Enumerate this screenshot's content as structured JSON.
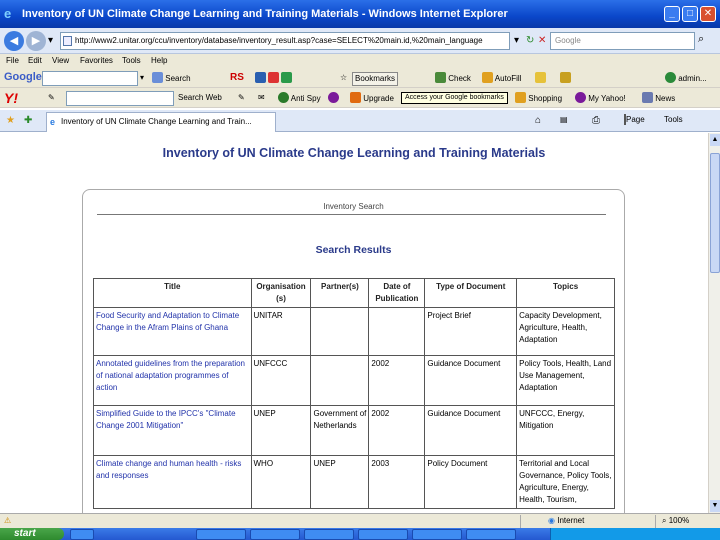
{
  "window": {
    "title": "Inventory of UN Climate Change Learning and Training Materials - Windows Internet Explorer",
    "minimize_label": "_",
    "maximize_label": "□",
    "close_label": "✕"
  },
  "address_bar": {
    "url": "http://www2.unitar.org/ccu/inventory/database/inventory_result.asp?case=SELECT%20main.id,%20main_language",
    "search_placeholder": "Google"
  },
  "menu": [
    "File",
    "Edit",
    "View",
    "Favorites",
    "Tools",
    "Help"
  ],
  "google_toolbar": {
    "logo": "Google",
    "search_label": "Search",
    "rss_label": "RS",
    "bookmarks_label": "Bookmarks",
    "check_label": "Check",
    "autofill_label": "AutoFill",
    "account_label": "admin..."
  },
  "yahoo_toolbar": {
    "logo": "Y!",
    "search_web_label": "Search Web",
    "anti_spy_label": "Anti Spy",
    "upgrade_label": "Upgrade",
    "tooltip": "Access your Google bookmarks",
    "shopping_label": "Shopping",
    "my_yahoo_label": "My Yahoo!",
    "news_label": "News"
  },
  "tabs": {
    "active_tab_title": "Inventory of UN Climate Change Learning and Train...",
    "page_label": "Page",
    "tools_label": "Tools"
  },
  "page": {
    "title": "Inventory of UN Climate Change Learning and Training Materials",
    "inventory_search_label": "Inventory Search",
    "results_title": "Search Results",
    "table": {
      "headers": [
        "Title",
        "Organisation (s)",
        "Partner(s)",
        "Date of Publication",
        "Type of Document",
        "Topics"
      ],
      "rows": [
        {
          "title": "Food Security and Adaptation to Climate Change in the Afram Plains of Ghana",
          "organisation": "UNITAR",
          "partners": "",
          "date": "",
          "type": "Project Brief",
          "topics": "Capacity Development, Agriculture, Health, Adaptation"
        },
        {
          "title": "Annotated guidelines from the preparation of national adaptation programmes of action",
          "organisation": "UNFCCC",
          "partners": "",
          "date": "2002",
          "type": "Guidance Document",
          "topics": "Policy Tools, Health, Land Use Management, Adaptation"
        },
        {
          "title": "Simplified Guide to the IPCC's \"Climate Change 2001 Mitigation\"",
          "organisation": "UNEP",
          "partners": "Government of Netherlands",
          "date": "2002",
          "type": "Guidance Document",
          "topics": "UNFCCC, Energy, Mitigation"
        },
        {
          "title": "Climate change and human health - risks and responses",
          "organisation": "WHO",
          "partners": "UNEP",
          "date": "2003",
          "type": "Policy Document",
          "topics": "Territorial and Local Governance, Policy Tools, Agriculture, Energy, Health, Tourism,"
        }
      ]
    }
  },
  "status_bar": {
    "zone": "Internet",
    "zoom": "100%"
  },
  "taskbar": {
    "start_label": "start"
  },
  "colors": {
    "title_blue": "#2a3a8a",
    "link_blue": "#2233aa",
    "titlebar": "#0a46c9"
  }
}
